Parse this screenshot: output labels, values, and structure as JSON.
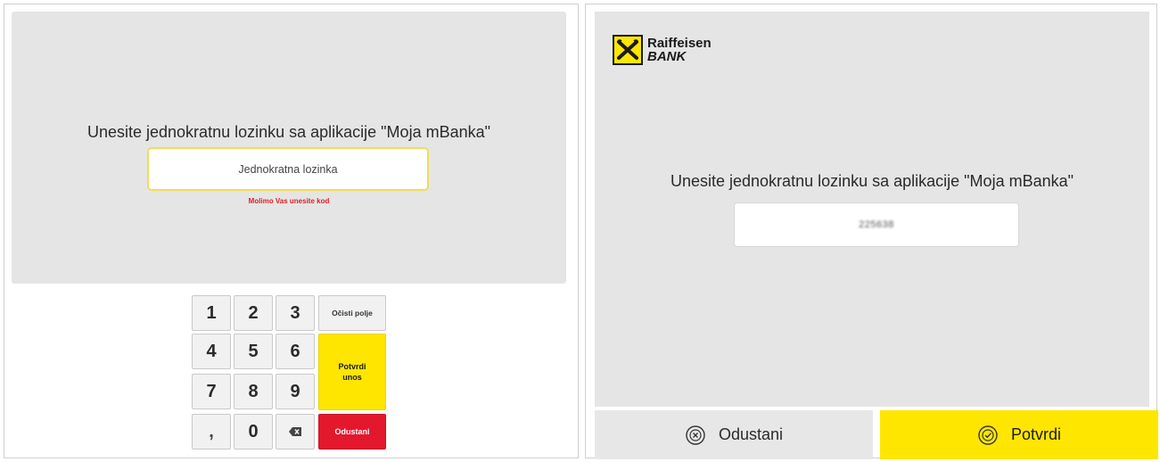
{
  "left": {
    "prompt": "Unesite jednokratnu lozinku sa aplikacije \"Moja mBanka\"",
    "input_placeholder": "Jednokratna lozinka",
    "error": "Molimo Vas unesite kod",
    "keypad": {
      "digits": [
        "1",
        "2",
        "3",
        "4",
        "5",
        "6",
        "7",
        "8",
        "9",
        ",",
        "0"
      ],
      "clear_label": "Očisti polje",
      "confirm_label_line1": "Potvrdi",
      "confirm_label_line2": "unos",
      "cancel_label": "Odustani",
      "backspace_icon": "backspace-icon"
    }
  },
  "right": {
    "brand_line1": "Raiffeisen",
    "brand_line2": "BANK",
    "prompt": "Unesite jednokratnu lozinku sa aplikacije \"Moja mBanka\"",
    "input_value": "225638",
    "cancel_label": "Odustani",
    "confirm_label": "Potvrdi",
    "cancel_icon": "cancel-circle-icon",
    "confirm_icon": "check-circle-icon"
  },
  "colors": {
    "accent_yellow": "#fee600",
    "error_red": "#e02020",
    "cancel_red": "#e3182d",
    "panel_gray": "#e5e5e5"
  }
}
